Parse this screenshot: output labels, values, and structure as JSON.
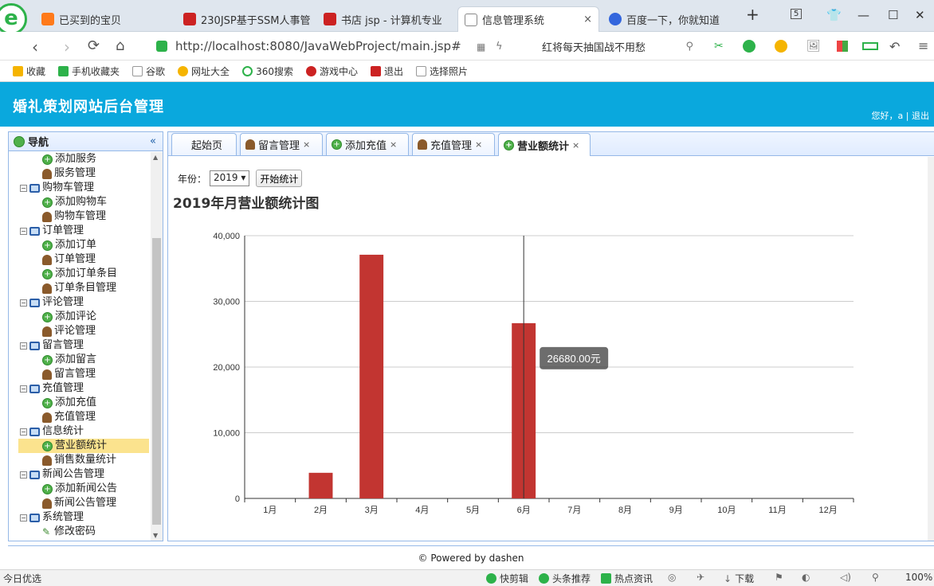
{
  "browser": {
    "tabs": [
      {
        "label": "已买到的宝贝",
        "color": "#ff7a1a"
      },
      {
        "label": "230JSP基于SSM人事管",
        "color": "#cc2222"
      },
      {
        "label": "书店 jsp - 计算机专业",
        "color": "#cc2222"
      },
      {
        "label": "信息管理系统",
        "color": "#888888",
        "close": "×"
      },
      {
        "label": "百度一下，你就知道",
        "color": "#3366dd"
      }
    ],
    "new_tab": "+",
    "tab_count": "5",
    "url": "http://localhost:8080/JavaWebProject/main.jsp#",
    "search_text": "红将每天抽国战不用愁",
    "bookmarks": [
      "收藏",
      "手机收藏夹",
      "谷歌",
      "网址大全",
      "360搜索",
      "游戏中心",
      "退出",
      "选择照片"
    ]
  },
  "app": {
    "title": "婚礼策划网站后台管理",
    "greeting": "您好，a",
    "separator": "|",
    "logout": "退出"
  },
  "nav": {
    "title": "导航",
    "collapse": "«",
    "items": [
      {
        "label": "添加服务",
        "level": 2,
        "icon": "add"
      },
      {
        "label": "服务管理",
        "level": 2,
        "icon": "user"
      },
      {
        "label": "购物车管理",
        "level": 1,
        "icon": "monitor"
      },
      {
        "label": "添加购物车",
        "level": 2,
        "icon": "add"
      },
      {
        "label": "购物车管理",
        "level": 2,
        "icon": "user"
      },
      {
        "label": "订单管理",
        "level": 1,
        "icon": "monitor"
      },
      {
        "label": "添加订单",
        "level": 2,
        "icon": "add"
      },
      {
        "label": "订单管理",
        "level": 2,
        "icon": "user"
      },
      {
        "label": "添加订单条目",
        "level": 2,
        "icon": "add"
      },
      {
        "label": "订单条目管理",
        "level": 2,
        "icon": "user"
      },
      {
        "label": "评论管理",
        "level": 1,
        "icon": "monitor"
      },
      {
        "label": "添加评论",
        "level": 2,
        "icon": "add"
      },
      {
        "label": "评论管理",
        "level": 2,
        "icon": "user"
      },
      {
        "label": "留言管理",
        "level": 1,
        "icon": "monitor"
      },
      {
        "label": "添加留言",
        "level": 2,
        "icon": "add"
      },
      {
        "label": "留言管理",
        "level": 2,
        "icon": "user"
      },
      {
        "label": "充值管理",
        "level": 1,
        "icon": "monitor"
      },
      {
        "label": "添加充值",
        "level": 2,
        "icon": "add"
      },
      {
        "label": "充值管理",
        "level": 2,
        "icon": "user"
      },
      {
        "label": "信息统计",
        "level": 1,
        "icon": "monitor"
      },
      {
        "label": "营业额统计",
        "level": 2,
        "icon": "add",
        "selected": true
      },
      {
        "label": "销售数量统计",
        "level": 2,
        "icon": "user"
      },
      {
        "label": "新闻公告管理",
        "level": 1,
        "icon": "monitor"
      },
      {
        "label": "添加新闻公告",
        "level": 2,
        "icon": "add"
      },
      {
        "label": "新闻公告管理",
        "level": 2,
        "icon": "user"
      },
      {
        "label": "系统管理",
        "level": 1,
        "icon": "monitor"
      },
      {
        "label": "修改密码",
        "level": 2,
        "icon": "pencil"
      }
    ]
  },
  "content_tabs": [
    {
      "label": "起始页",
      "icon": "",
      "close": ""
    },
    {
      "label": "留言管理",
      "icon": "user",
      "close": "×"
    },
    {
      "label": "添加充值",
      "icon": "add",
      "close": "×"
    },
    {
      "label": "充值管理",
      "icon": "user",
      "close": "×"
    },
    {
      "label": "营业额统计",
      "icon": "add",
      "close": "×",
      "active": true
    }
  ],
  "filter": {
    "year_label": "年份：",
    "year_value": "2019",
    "button": "开始统计"
  },
  "chart_title": "2019年月营业额统计图",
  "chart_data": {
    "type": "bar",
    "categories": [
      "1月",
      "2月",
      "3月",
      "4月",
      "5月",
      "6月",
      "7月",
      "8月",
      "9月",
      "10月",
      "11月",
      "12月"
    ],
    "values": [
      0,
      3900,
      37100,
      0,
      0,
      26680,
      0,
      0,
      0,
      0,
      0,
      0
    ],
    "ylim": [
      0,
      40000
    ],
    "yticks": [
      "0",
      "10,000",
      "20,000",
      "30,000",
      "40,000"
    ],
    "bar_color": "#c23531",
    "grid": true,
    "tooltip": {
      "category": "6月",
      "text": "26680.00元"
    }
  },
  "footer": "© Powered by dashen",
  "statusbar": {
    "left": "今日优选",
    "items": [
      "快剪辑",
      "头条推荐",
      "热点资讯",
      "下载"
    ],
    "zoom": "100%"
  }
}
